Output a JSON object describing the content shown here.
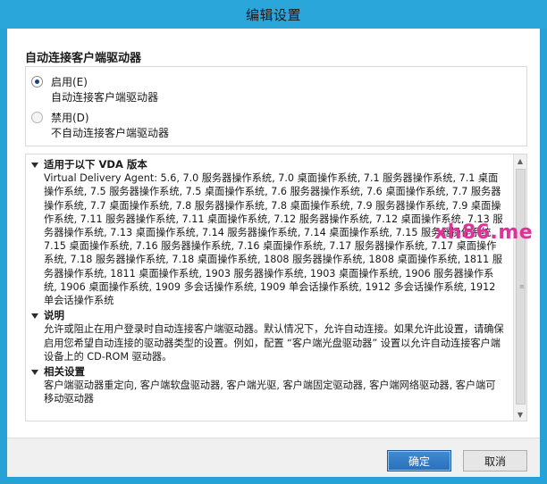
{
  "window": {
    "title": "编辑设置"
  },
  "setting": {
    "name": "自动连接客户端驱动器",
    "options": [
      {
        "label": "启用(E)",
        "desc": "自动连接客户端驱动器",
        "selected": true
      },
      {
        "label": "禁用(D)",
        "desc": "不自动连接客户端驱动器",
        "selected": false
      }
    ]
  },
  "info": {
    "applies_to": {
      "heading": "适用于以下 VDA 版本",
      "body": "Virtual Delivery Agent: 5.6, 7.0 服务器操作系统, 7.0 桌面操作系统, 7.1 服务器操作系统, 7.1 桌面操作系统, 7.5 服务器操作系统, 7.5 桌面操作系统, 7.6 服务器操作系统, 7.6 桌面操作系统, 7.7 服务器操作系统, 7.7 桌面操作系统, 7.8 服务器操作系统, 7.8 桌面操作系统, 7.9 服务器操作系统, 7.9 桌面操作系统, 7.11 服务器操作系统, 7.11 桌面操作系统, 7.12 服务器操作系统, 7.12 桌面操作系统, 7.13 服务器操作系统, 7.13 桌面操作系统, 7.14 服务器操作系统, 7.14 桌面操作系统, 7.15 服务器操作系统, 7.15 桌面操作系统, 7.16 服务器操作系统, 7.16 桌面操作系统, 7.17 服务器操作系统, 7.17 桌面操作系统, 7.18 服务器操作系统, 7.18 桌面操作系统, 1808 服务器操作系统, 1808 桌面操作系统, 1811 服务器操作系统, 1811 桌面操作系统, 1903 服务器操作系统, 1903 桌面操作系统, 1906 服务器操作系统, 1906 桌面操作系统, 1909 多会话操作系统, 1909 单会话操作系统, 1912 多会话操作系统, 1912 单会话操作系统"
    },
    "description": {
      "heading": "说明",
      "body": "允许或阻止在用户登录时自动连接客户端驱动器。默认情况下，允许自动连接。如果允许此设置，请确保启用您希望自动连接的驱动器类型的设置。例如，配置 “客户端光盘驱动器” 设置以允许自动连接客户端设备上的 CD-ROM 驱动器。"
    },
    "related": {
      "heading": "相关设置",
      "body": "客户端驱动器重定向, 客户端软盘驱动器, 客户端光驱, 客户端固定驱动器, 客户端网络驱动器, 客户端可移动驱动器"
    }
  },
  "buttons": {
    "ok": "确定",
    "cancel": "取消"
  },
  "watermark": {
    "text": "xh86.me"
  },
  "colors": {
    "titlebar": "#2aa6da",
    "ok_button": "#2b6fb7",
    "watermark": "#e0309a"
  }
}
